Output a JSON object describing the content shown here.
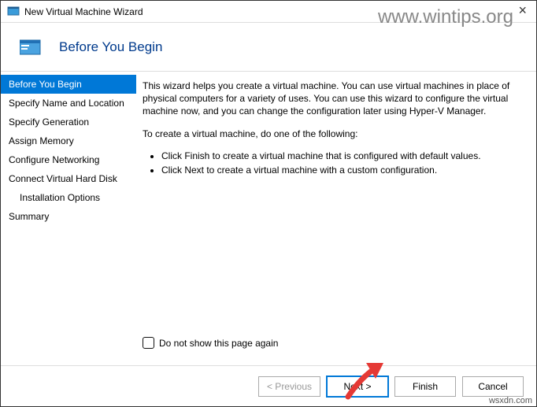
{
  "window": {
    "title": "New Virtual Machine Wizard",
    "close_glyph": "×"
  },
  "watermark": "www.wintips.org",
  "attribution": "wsxdn.com",
  "header": {
    "title": "Before You Begin"
  },
  "sidebar": {
    "items": [
      {
        "label": "Before You Begin",
        "selected": true
      },
      {
        "label": "Specify Name and Location"
      },
      {
        "label": "Specify Generation"
      },
      {
        "label": "Assign Memory"
      },
      {
        "label": "Configure Networking"
      },
      {
        "label": "Connect Virtual Hard Disk"
      },
      {
        "label": "Installation Options",
        "indent": true
      },
      {
        "label": "Summary"
      }
    ]
  },
  "content": {
    "para1": "This wizard helps you create a virtual machine. You can use virtual machines in place of physical computers for a variety of uses. You can use this wizard to configure the virtual machine now, and you can change the configuration later using Hyper-V Manager.",
    "para2": "To create a virtual machine, do one of the following:",
    "bullet1": "Click Finish to create a virtual machine that is configured with default values.",
    "bullet2": "Click Next to create a virtual machine with a custom configuration.",
    "checkbox_label": "Do not show this page again"
  },
  "footer": {
    "previous": "< Previous",
    "next": "Next >",
    "finish": "Finish",
    "cancel": "Cancel"
  }
}
